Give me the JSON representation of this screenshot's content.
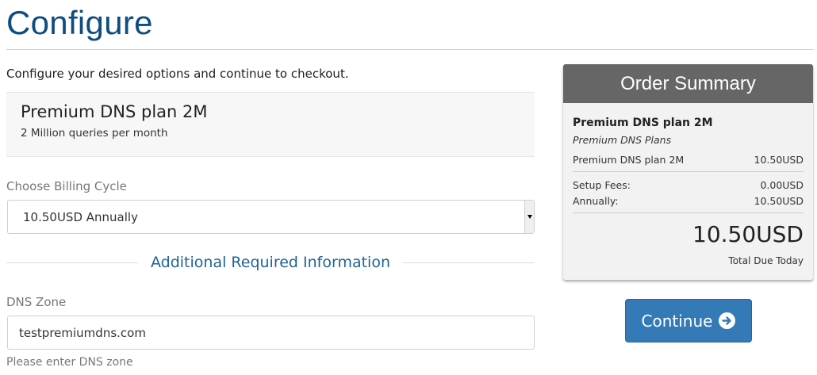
{
  "page": {
    "title": "Configure",
    "intro": "Configure your desired options and continue to checkout."
  },
  "product": {
    "name": "Premium DNS plan 2M",
    "description": "2 Million queries per month"
  },
  "billing": {
    "label": "Choose Billing Cycle",
    "selected": "10.50USD Annually"
  },
  "additional": {
    "heading": "Additional Required Information",
    "dns_zone": {
      "label": "DNS Zone",
      "value": "testpremiumdns.com",
      "help": "Please enter DNS zone"
    }
  },
  "summary": {
    "title": "Order Summary",
    "product_name": "Premium DNS plan 2M",
    "product_group": "Premium DNS Plans",
    "line_item": {
      "label": "Premium DNS plan 2M",
      "value": "10.50USD"
    },
    "setup_fees": {
      "label": "Setup Fees:",
      "value": "0.00USD"
    },
    "annually": {
      "label": "Annually:",
      "value": "10.50USD"
    },
    "total": "10.50USD",
    "total_label": "Total Due Today"
  },
  "actions": {
    "continue_label": "Continue",
    "continue_icon": "arrow-circle-right-icon"
  },
  "colors": {
    "title": "#0f4c81",
    "accent": "#1f6396",
    "button": "#337ab7",
    "summary_header": "#666666"
  }
}
